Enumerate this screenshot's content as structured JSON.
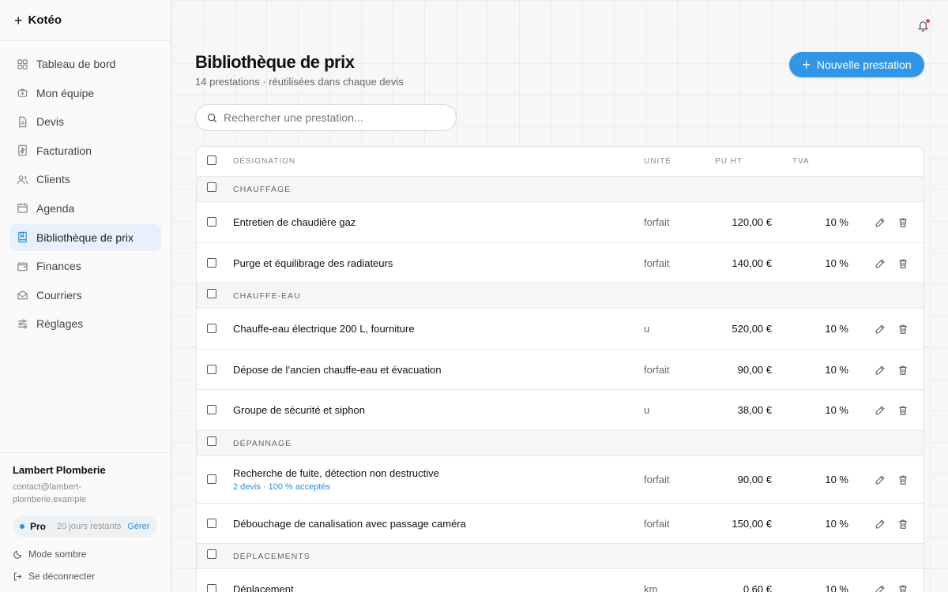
{
  "app": {
    "name": "Kotéo"
  },
  "sidebar": {
    "items": [
      {
        "label": "Tableau de bord",
        "icon": "dashboard-icon"
      },
      {
        "label": "Mon équipe",
        "icon": "team-icon"
      },
      {
        "label": "Devis",
        "icon": "document-icon"
      },
      {
        "label": "Facturation",
        "icon": "invoice-icon"
      },
      {
        "label": "Clients",
        "icon": "users-icon"
      },
      {
        "label": "Agenda",
        "icon": "calendar-icon"
      },
      {
        "label": "Bibliothèque de prix",
        "icon": "book-icon",
        "active": true
      },
      {
        "label": "Finances",
        "icon": "wallet-icon"
      },
      {
        "label": "Courriers",
        "icon": "mail-icon"
      },
      {
        "label": "Réglages",
        "icon": "sliders-icon"
      }
    ],
    "footer": {
      "org": "Lambert Plomberie",
      "email": "contact@lambert-plomberie.example",
      "plan": "Pro",
      "days_left": "20 jours restants",
      "manage": "Gérer",
      "dark_mode": "Mode sombre",
      "logout": "Se déconnecter"
    }
  },
  "header": {
    "title": "Bibliothèque de prix",
    "subtitle": "14 prestations · réutilisées dans chaque devis",
    "new_button": "Nouvelle prestation"
  },
  "search": {
    "placeholder": "Rechercher une prestation...",
    "value": ""
  },
  "table": {
    "columns": {
      "designation": "DÉSIGNATION",
      "unit": "UNITÉ",
      "price": "PU HT",
      "vat": "TVA"
    },
    "groups": [
      {
        "category": "CHAUFFAGE",
        "items": [
          {
            "name": "Entretien de chaudière gaz",
            "unit": "forfait",
            "price": "120,00 €",
            "vat": "10 %"
          },
          {
            "name": "Purge et équilibrage des radiateurs",
            "unit": "forfait",
            "price": "140,00 €",
            "vat": "10 %"
          }
        ]
      },
      {
        "category": "CHAUFFE-EAU",
        "items": [
          {
            "name": "Chauffe-eau électrique 200 L, fourniture",
            "unit": "u",
            "price": "520,00 €",
            "vat": "10 %"
          },
          {
            "name": "Dépose de l’ancien chauffe-eau et évacuation",
            "unit": "forfait",
            "price": "90,00 €",
            "vat": "10 %"
          },
          {
            "name": "Groupe de sécurité et siphon",
            "unit": "u",
            "price": "38,00 €",
            "vat": "10 %"
          }
        ]
      },
      {
        "category": "DÉPANNAGE",
        "items": [
          {
            "name": "Recherche de fuite, détection non destructive",
            "sub": "2 devis · 100 % acceptés",
            "unit": "forfait",
            "price": "90,00 €",
            "vat": "10 %"
          },
          {
            "name": "Débouchage de canalisation avec passage caméra",
            "unit": "forfait",
            "price": "150,00 €",
            "vat": "10 %"
          }
        ]
      },
      {
        "category": "DÉPLACEMENTS",
        "items": [
          {
            "name": "Déplacement",
            "unit": "km",
            "price": "0,60 €",
            "vat": "10 %"
          }
        ]
      }
    ]
  },
  "colors": {
    "accent": "#3097e8",
    "active_bg": "#e8f1fb",
    "notification": "#e5484d"
  }
}
